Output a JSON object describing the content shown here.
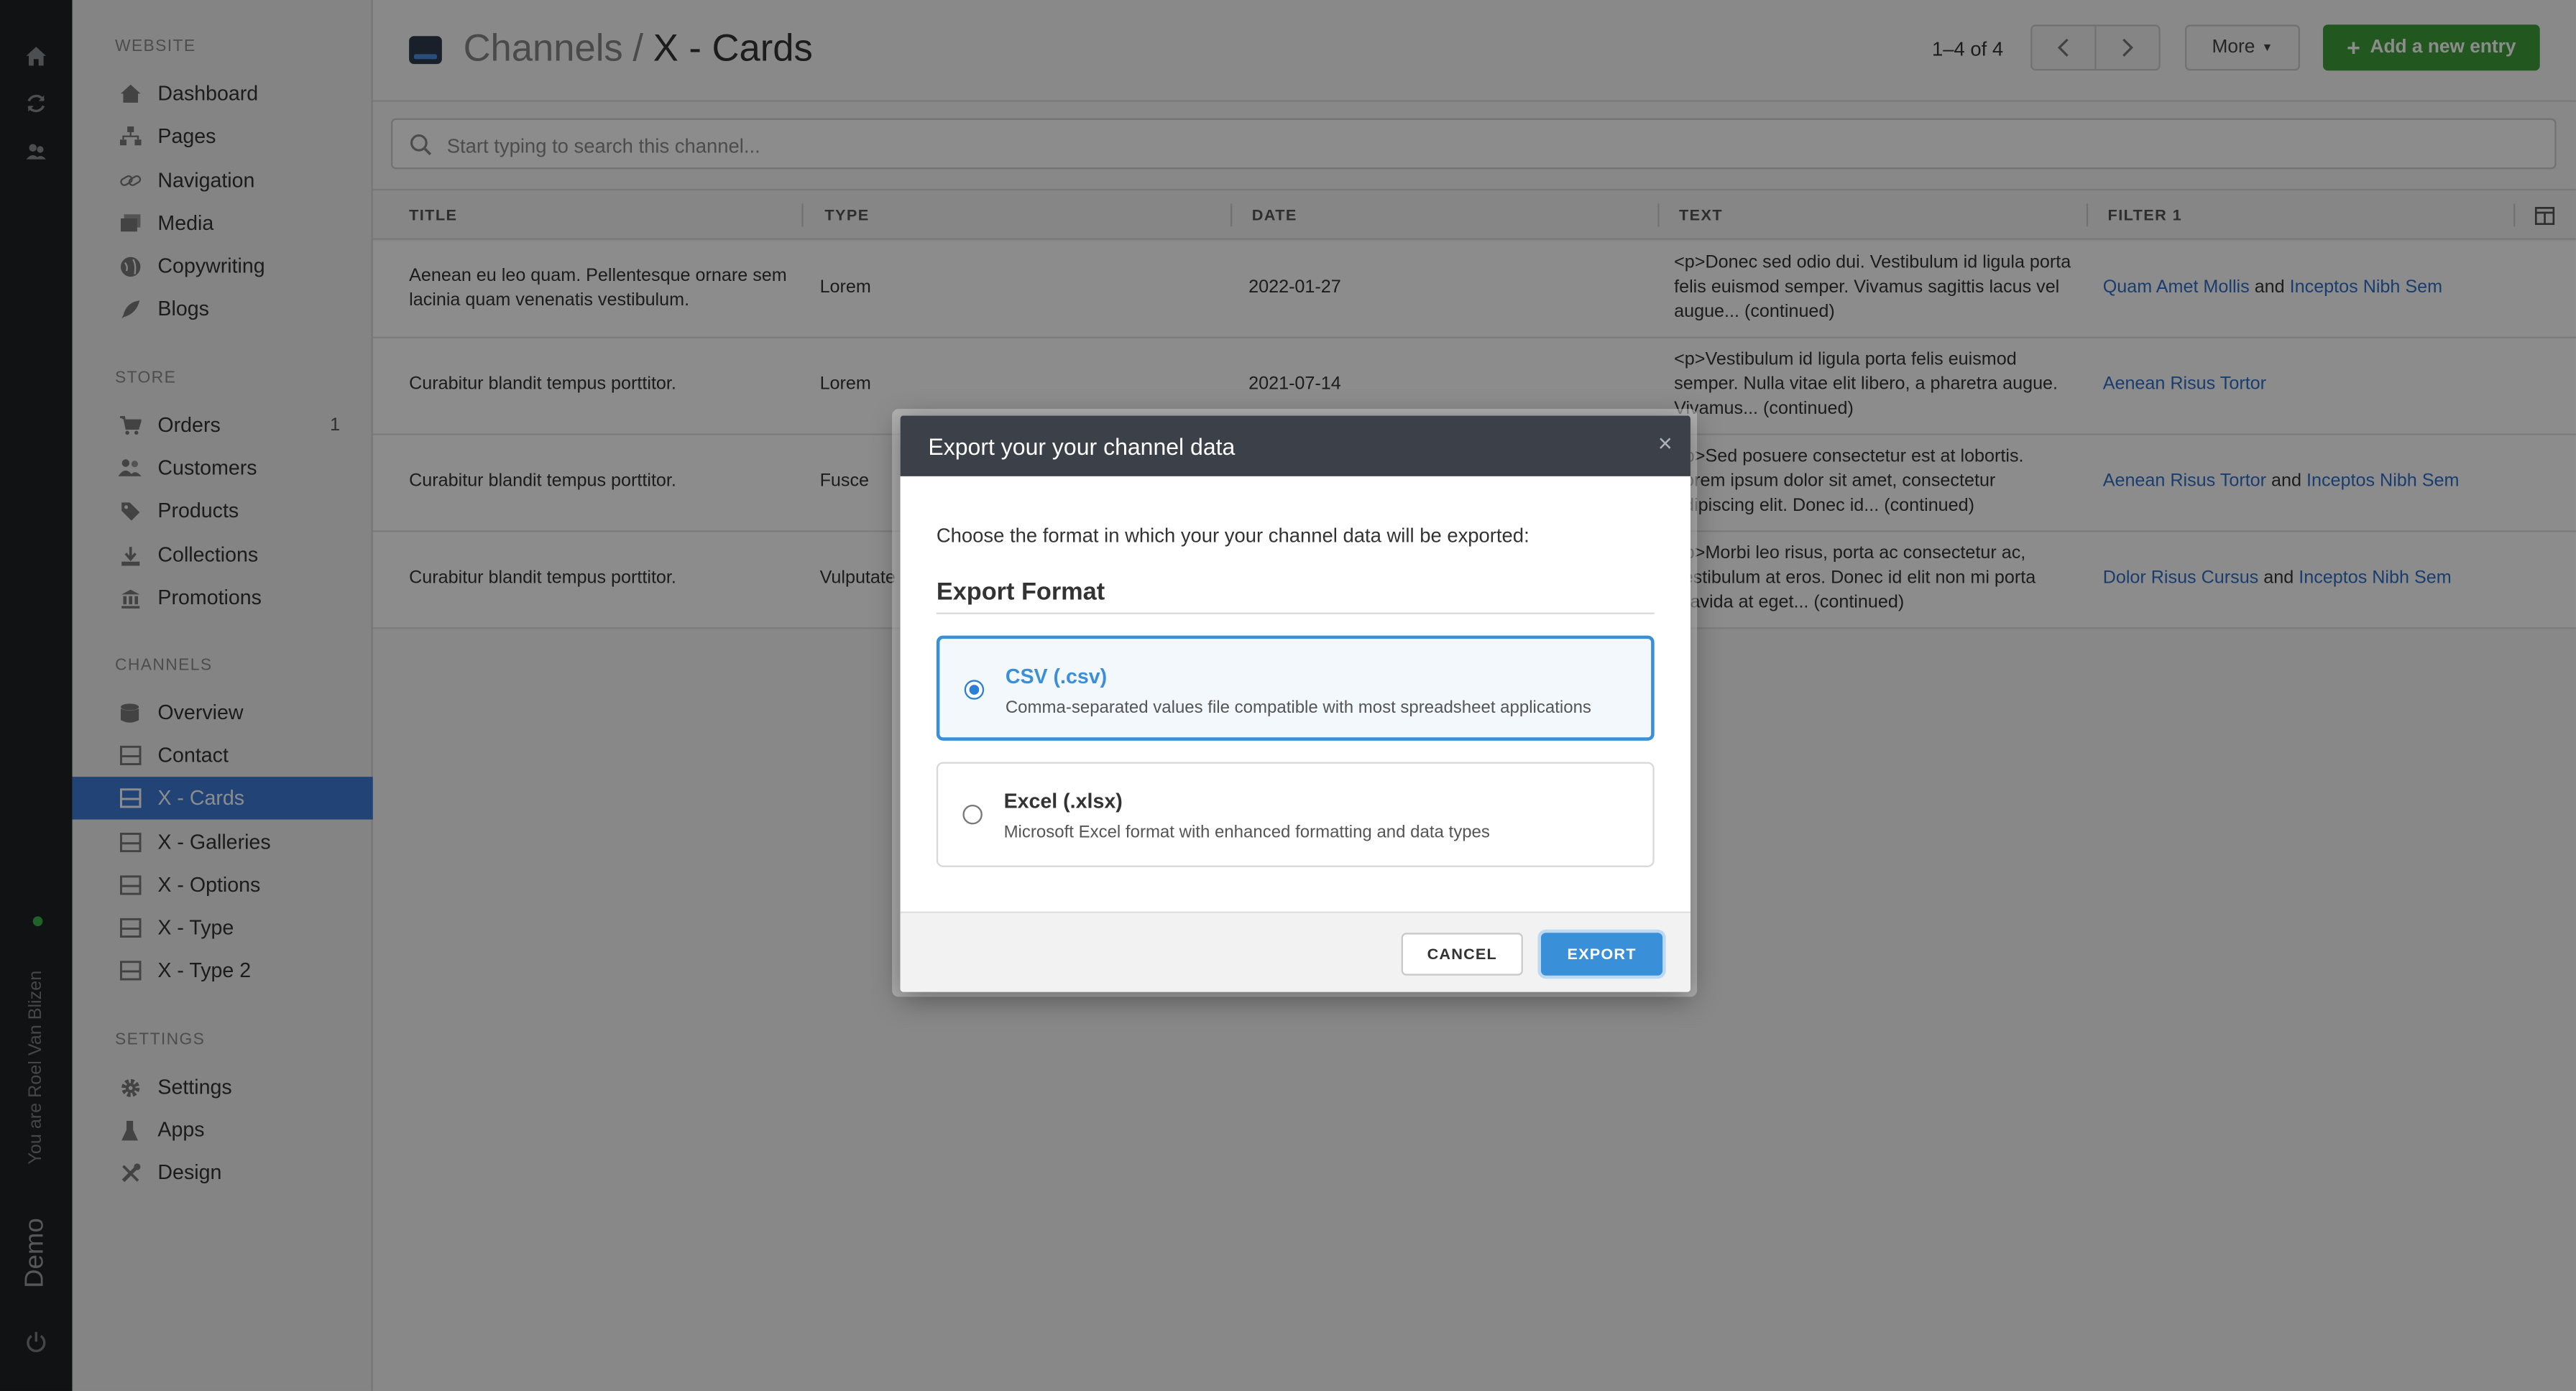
{
  "rail": {
    "icons": [
      "home-icon",
      "refresh-icon",
      "people-icon",
      "power-icon"
    ],
    "user_label": "You are Roel Van Blizen",
    "env_label": "Demo"
  },
  "sidebar": {
    "sections": [
      {
        "title": "Website",
        "items": [
          "Dashboard",
          "Pages",
          "Navigation",
          "Media",
          "Copywriting",
          "Blogs"
        ]
      },
      {
        "title": "Store",
        "items": [
          "Orders",
          "Customers",
          "Products",
          "Collections",
          "Promotions"
        ],
        "orders_count": "1"
      },
      {
        "title": "Channels",
        "items": [
          "Overview",
          "Contact",
          "X - Cards",
          "X - Galleries",
          "X - Options",
          "X - Type",
          "X - Type 2"
        ]
      },
      {
        "title": "Settings",
        "items": [
          "Settings",
          "Apps",
          "Design"
        ]
      }
    ],
    "active_item": "X - Cards"
  },
  "header": {
    "breadcrumb_parent": "Channels",
    "breadcrumb_sep": "/",
    "breadcrumb_current": "X - Cards",
    "pager_text": "1–4 of 4",
    "more_label": "More",
    "add_label": "Add a new entry"
  },
  "search": {
    "placeholder": "Start typing to search this channel..."
  },
  "table": {
    "columns": [
      "Title",
      "Type",
      "Date",
      "Text",
      "Filter 1"
    ],
    "rows": [
      {
        "title": "Aenean eu leo quam. Pellentesque ornare sem lacinia quam venenatis vestibulum.",
        "type": "Lorem",
        "date": "2022-01-27",
        "text": "<p>Donec sed odio dui. Vestibulum id ligula porta felis euismod semper. Vivamus sagittis lacus vel augue... (continued)",
        "filter_a": "Quam Amet Mollis",
        "filter_and": "and",
        "filter_b": "Inceptos Nibh Sem"
      },
      {
        "title": "Curabitur blandit tempus porttitor.",
        "type": "Lorem",
        "date": "2021-07-14",
        "text": "<p>Vestibulum id ligula porta felis euismod semper. Nulla vitae elit libero, a pharetra augue. Vivamus... (continued)",
        "filter_a": "Aenean Risus Tortor",
        "filter_and": "",
        "filter_b": ""
      },
      {
        "title": "Curabitur blandit tempus porttitor.",
        "type": "Fusce",
        "date": "",
        "text": "<p>Sed posuere consectetur est at lobortis. Lorem ipsum dolor sit amet, consectetur adipiscing elit. Donec id... (continued)",
        "filter_a": "Aenean Risus Tortor",
        "filter_and": "and",
        "filter_b": "Inceptos Nibh Sem"
      },
      {
        "title": "Curabitur blandit tempus porttitor.",
        "type": "Vulputate",
        "date": "",
        "text": "<p>Morbi leo risus, porta ac consectetur ac, vestibulum at eros. Donec id elit non mi porta gravida at eget... (continued)",
        "filter_a": "Dolor Risus Cursus",
        "filter_and": "and",
        "filter_b": "Inceptos Nibh Sem"
      }
    ]
  },
  "modal": {
    "title": "Export your your channel data",
    "close": "×",
    "description": "Choose the format in which your your channel data will be exported:",
    "section_title": "Export Format",
    "options": [
      {
        "title": "CSV (.csv)",
        "description": "Comma-separated values file compatible with most spreadsheet applications",
        "selected": true
      },
      {
        "title": "Excel (.xlsx)",
        "description": "Microsoft Excel format with enhanced formatting and data types",
        "selected": false
      }
    ],
    "cancel_label": "CANCEL",
    "export_label": "EXPORT"
  },
  "colors": {
    "accent": "#3b8fd8",
    "add_button": "#3f9f3a",
    "sidebar_active": "#3d7ad6",
    "modal_header": "#3b4049"
  }
}
